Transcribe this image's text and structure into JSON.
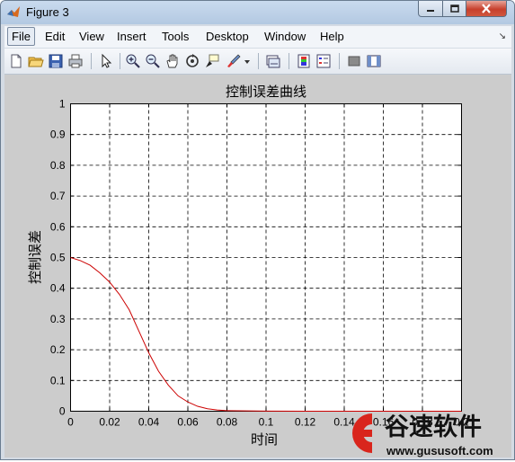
{
  "window": {
    "title": "Figure 3",
    "controls": [
      "minimize",
      "maximize",
      "close"
    ]
  },
  "menubar": {
    "items": [
      {
        "label": "File"
      },
      {
        "label": "Edit"
      },
      {
        "label": "View"
      },
      {
        "label": "Insert"
      },
      {
        "label": "Tools"
      },
      {
        "label": "Desktop"
      },
      {
        "label": "Window"
      },
      {
        "label": "Help"
      }
    ]
  },
  "toolbar": {
    "buttons": [
      {
        "icon": "new-figure-icon"
      },
      {
        "icon": "open-file-icon"
      },
      {
        "icon": "save-icon"
      },
      {
        "icon": "print-icon"
      },
      {
        "icon": "edit-plot-arrow-icon"
      },
      {
        "icon": "zoom-in-icon"
      },
      {
        "icon": "zoom-out-icon"
      },
      {
        "icon": "pan-hand-icon"
      },
      {
        "icon": "rotate-3d-icon"
      },
      {
        "icon": "data-cursor-icon"
      },
      {
        "icon": "brush-icon"
      },
      {
        "icon": "link-plot-icon"
      },
      {
        "icon": "colorbar-icon"
      },
      {
        "icon": "legend-icon"
      },
      {
        "icon": "hide-plot-tools-icon"
      },
      {
        "icon": "show-plot-tools-icon"
      }
    ]
  },
  "chart_data": {
    "type": "line",
    "title": "控制误差曲线",
    "xlabel": "时间",
    "ylabel": "控制误差",
    "xlim": [
      0,
      0.2
    ],
    "ylim": [
      0,
      1
    ],
    "xticks": [
      "0",
      "0.02",
      "0.04",
      "0.06",
      "0.08",
      "0.1",
      "0.12",
      "0.14",
      "0.16",
      "0.18",
      "0.2"
    ],
    "yticks": [
      "0",
      "0.1",
      "0.2",
      "0.3",
      "0.4",
      "0.5",
      "0.6",
      "0.7",
      "0.8",
      "0.9",
      "1"
    ],
    "grid": true,
    "series": [
      {
        "color": "#cc0000",
        "x": [
          0,
          0.005,
          0.01,
          0.015,
          0.02,
          0.025,
          0.03,
          0.035,
          0.04,
          0.045,
          0.05,
          0.055,
          0.06,
          0.065,
          0.07,
          0.075,
          0.08,
          0.09,
          0.1,
          0.12,
          0.14,
          0.16,
          0.18,
          0.2
        ],
        "y": [
          0.5,
          0.49,
          0.475,
          0.45,
          0.42,
          0.38,
          0.33,
          0.26,
          0.19,
          0.13,
          0.085,
          0.05,
          0.03,
          0.016,
          0.008,
          0.004,
          0.002,
          0.001,
          0.0005,
          0,
          0,
          0,
          0,
          0
        ]
      }
    ]
  },
  "watermark": {
    "brand": "谷速软件",
    "url": "www.gususoft.com",
    "colors": {
      "logo_red": "#d9251c"
    }
  }
}
